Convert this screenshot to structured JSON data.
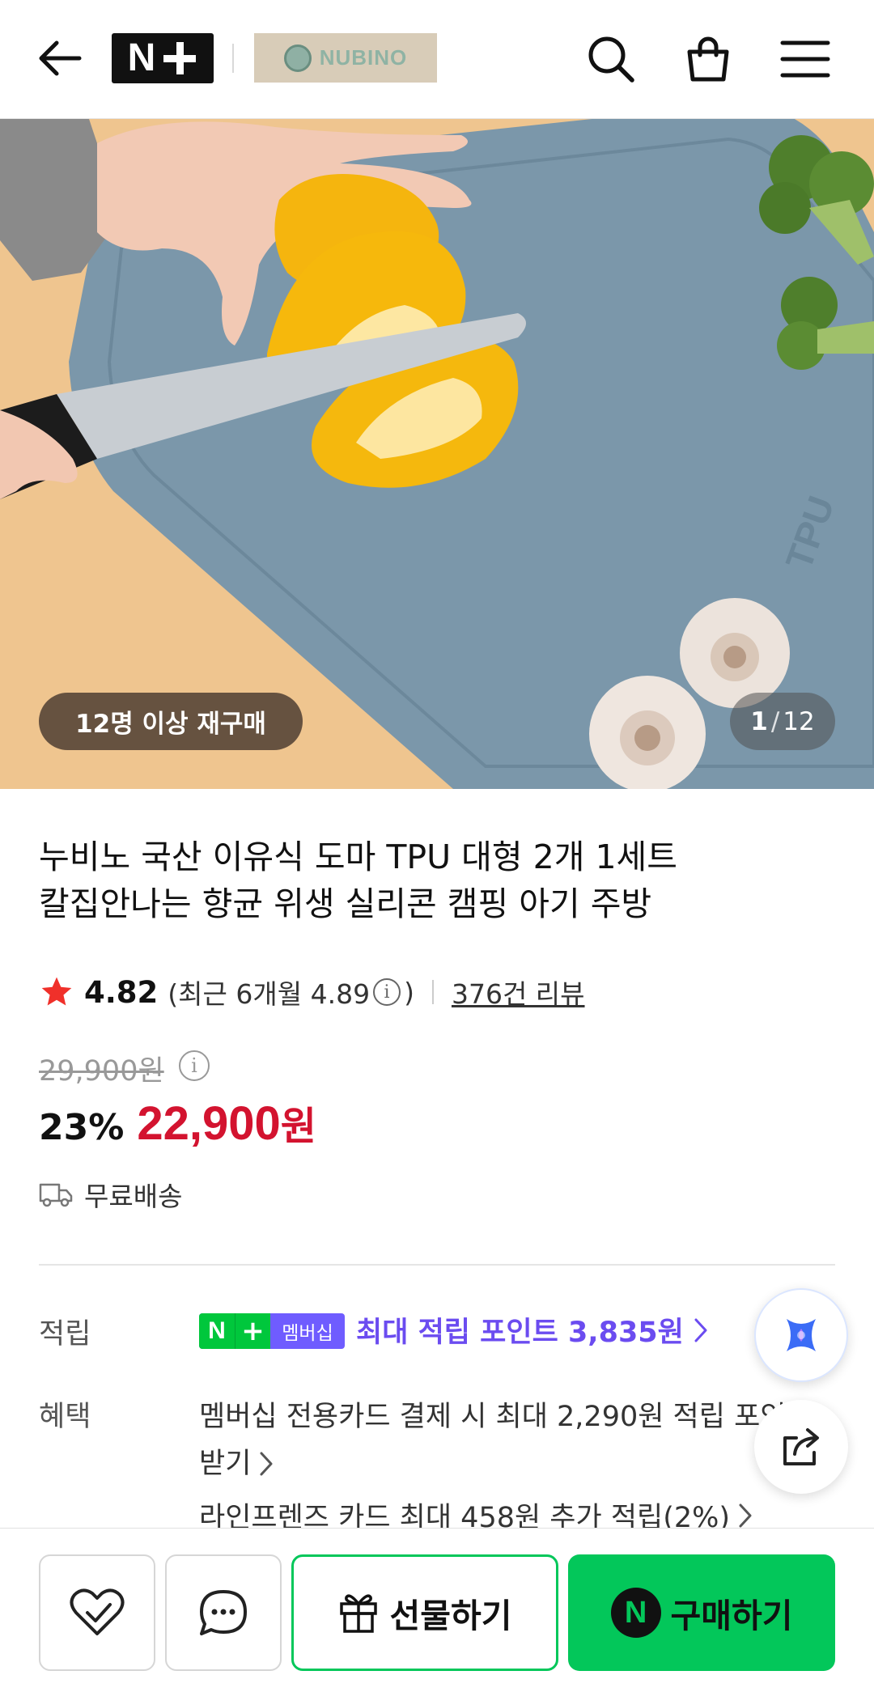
{
  "header": {
    "brand_text": "NUBINO"
  },
  "hero": {
    "repurchase_badge": "12명 이상 재구매",
    "image_current": "1",
    "image_separator": "/",
    "image_total": "12"
  },
  "product": {
    "title_line1": "누비노 국산 이유식 도마 TPU 대형 2개 1세트",
    "title_line2": "칼집안나는 향균 위생 실리콘 캠핑 아기 주방",
    "rating": "4.82",
    "recent_rating": "(최근 6개월 4.89",
    "recent_rating_close": ")",
    "review_count": "376건 리뷰",
    "original_price": "29,900원",
    "discount_rate": "23%",
    "sale_price": "22,900",
    "sale_unit": "원",
    "shipping": "무료배송"
  },
  "points": {
    "label": "적립",
    "badge_text": "멤버십",
    "text": "최대 적립 포인트 3,835원"
  },
  "benefits": {
    "label": "혜택",
    "line1": "멤버십 전용카드 결제 시 최대 2,290원 적립 포인트",
    "line1_cont": "받기",
    "line2": "라인프렌즈 카드 최대 458원 추가 적립(2%)"
  },
  "bottom_bar": {
    "gift_label": "선물하기",
    "buy_label": "구매하기"
  },
  "colors": {
    "accent_green": "#03c75a",
    "price_red": "#d3132f",
    "point_purple": "#6b4cf0"
  }
}
